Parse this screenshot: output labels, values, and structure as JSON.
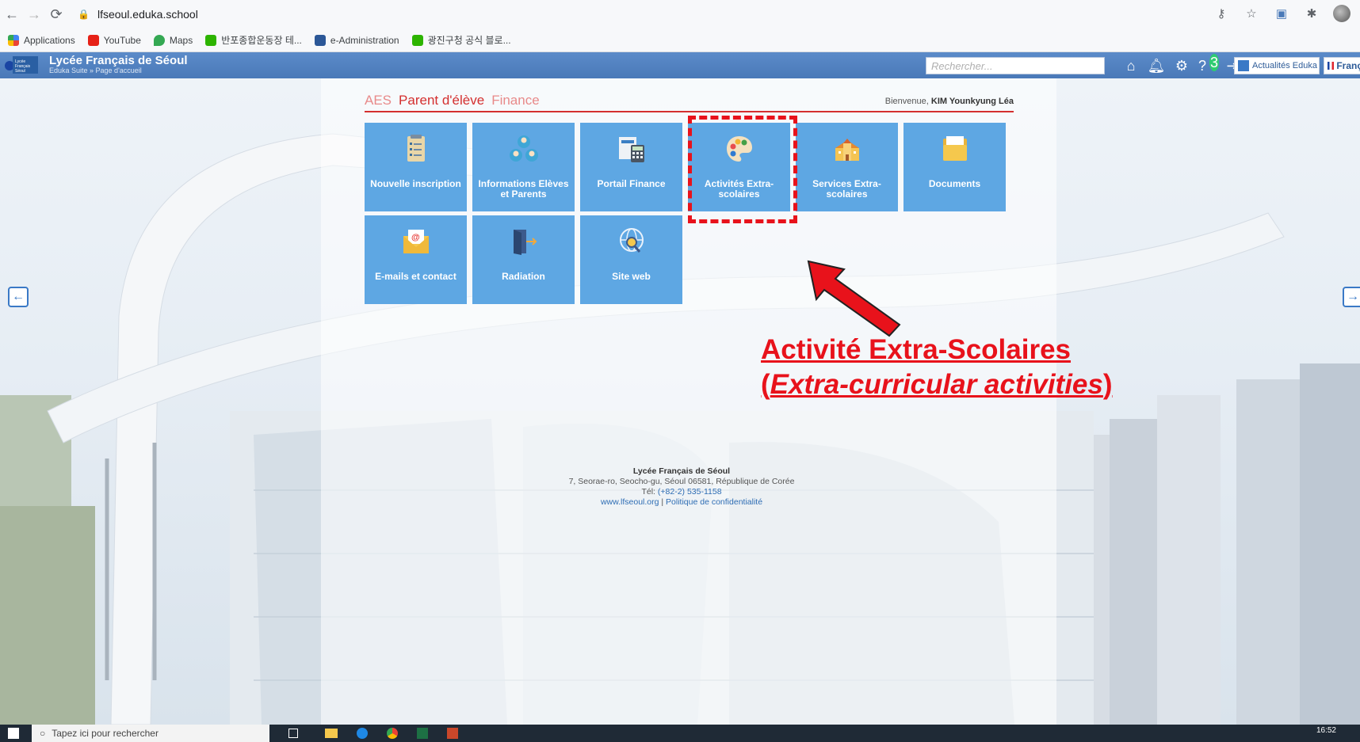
{
  "browser": {
    "url": "lfseoul.eduka.school",
    "bookmarks": [
      "Applications",
      "YouTube",
      "Maps",
      "반포종합운동장 테...",
      "e-Administration",
      "광진구청 공식 블로..."
    ]
  },
  "header": {
    "title": "Lycée Français de Séoul",
    "breadcrumb": "Eduka Suite » Page d'accueil",
    "search_placeholder": "Rechercher...",
    "notif_count": "3",
    "news_button": "Actualités Eduka",
    "language": "Franç",
    "logo_text": "Lycée Français Séoul"
  },
  "tabs": [
    "AES",
    "Parent d'élève",
    "Finance"
  ],
  "welcome": {
    "prefix": "Bienvenue,",
    "name": "KIM Younkyung Léa"
  },
  "tiles": [
    {
      "label": "Nouvelle inscription",
      "icon": "clipboard-icon"
    },
    {
      "label": "Informations Elèves et Parents",
      "icon": "people-icon"
    },
    {
      "label": "Portail Finance",
      "icon": "calculator-icon"
    },
    {
      "label": "Activités Extra-scolaires",
      "icon": "palette-icon"
    },
    {
      "label": "Services Extra-scolaires",
      "icon": "school-icon"
    },
    {
      "label": "Documents",
      "icon": "folder-icon"
    },
    {
      "label": "E-mails et contact",
      "icon": "email-icon"
    },
    {
      "label": "Radiation",
      "icon": "door-exit-icon"
    },
    {
      "label": "Site web",
      "icon": "web-search-icon"
    }
  ],
  "annotation": {
    "line1": "Activité Extra-Scolaires",
    "line2_open": "(",
    "line2_italic": "Extra-curricular activities",
    "line2_close": ")"
  },
  "footer": {
    "school": "Lycée Français de Séoul",
    "address": "7, Seorae-ro, Seocho-gu, Séoul 06581, République de Corée",
    "tel_label": "Tél:",
    "tel": "(+82-2) 535-1158",
    "site": "www.lfseoul.org",
    "separator": "|",
    "privacy": "Politique de confidentialité"
  },
  "taskbar": {
    "search_placeholder": "Tapez ici pour rechercher",
    "time": "16:52"
  },
  "colors": {
    "accent": "#5ea7e3",
    "header": "#4a79b8",
    "tab_active": "#d42f2f",
    "annotation": "#e8121b"
  }
}
